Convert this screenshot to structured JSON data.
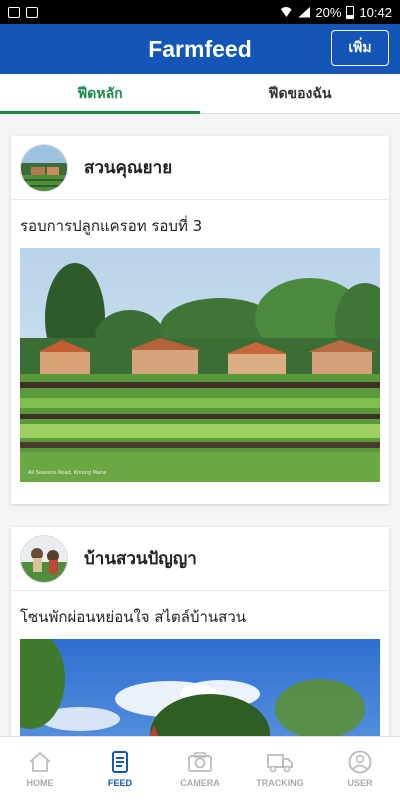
{
  "status_bar": {
    "battery": "20%",
    "time": "10:42"
  },
  "header": {
    "title": "Farmfeed",
    "add_label": "เพิ่ม"
  },
  "tabs": [
    {
      "label": "ฟีดหลัก",
      "active": true
    },
    {
      "label": "ฟีดของฉัน",
      "active": false
    }
  ],
  "posts": [
    {
      "author": "สวนคุณยาย",
      "caption": "รอบการปลูกแครอท รอบที่ 3",
      "image_watermark": "All Seasons Road, Khlong Mane"
    },
    {
      "author": "บ้านสวนปัญญา",
      "caption": "โซนพักผ่อนหย่อนใจ สไตล์บ้านสวน"
    }
  ],
  "bottom_nav": [
    {
      "label": "HOME",
      "icon": "home-icon",
      "active": false
    },
    {
      "label": "FEED",
      "icon": "feed-icon",
      "active": true
    },
    {
      "label": "CAMERA",
      "icon": "camera-icon",
      "active": false
    },
    {
      "label": "TRACKING",
      "icon": "truck-icon",
      "active": false
    },
    {
      "label": "USER",
      "icon": "user-icon",
      "active": false
    }
  ],
  "colors": {
    "header_bg": "#1456b8",
    "tab_active": "#1a8a4a",
    "nav_active": "#1456b8",
    "nav_inactive": "#aaaaaa"
  }
}
